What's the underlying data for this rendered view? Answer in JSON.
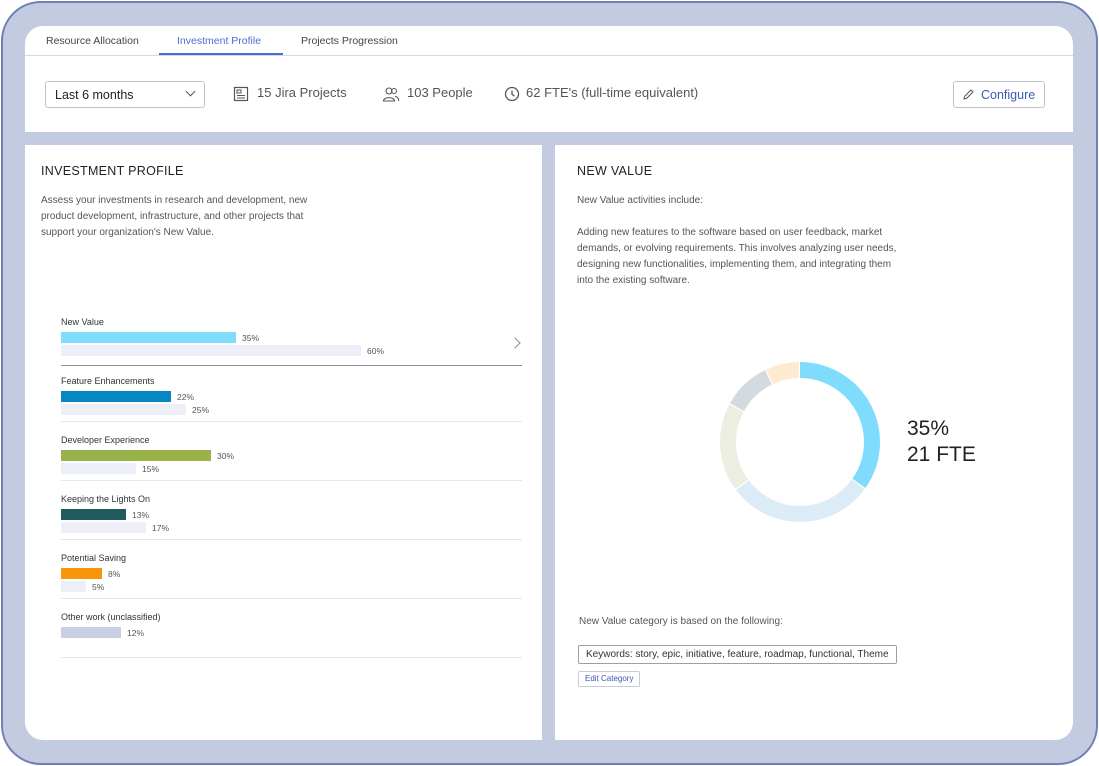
{
  "tabs": [
    {
      "label": "Resource Allocation"
    },
    {
      "label": "Investment Profile"
    },
    {
      "label": "Projects Progression"
    }
  ],
  "filter": {
    "period": "Last 6 months",
    "stats": {
      "projects": "15 Jira Projects",
      "people": "103 People",
      "fte": "62 FTE's (full-time equivalent)"
    },
    "configure_label": "Configure"
  },
  "investment_profile": {
    "title": "INVESTMENT PROFILE",
    "description_lines": [
      "Assess your investments in research and development, new",
      "product development, infrastructure, and other projects that",
      "support your organization's New Value."
    ],
    "categories": [
      {
        "name": "New Value",
        "current": 35,
        "current_label": "35%",
        "benchmark": 60,
        "benchmark_label": "60%",
        "color": "#7fdcfc"
      },
      {
        "name": "Feature Enhancements",
        "current": 22,
        "current_label": "22%",
        "benchmark": 25,
        "benchmark_label": "25%",
        "color": "#0787c2"
      },
      {
        "name": "Developer Experience",
        "current": 30,
        "current_label": "30%",
        "benchmark": 15,
        "benchmark_label": "15%",
        "color": "#99b24a"
      },
      {
        "name": "Keeping the Lights On",
        "current": 13,
        "current_label": "13%",
        "benchmark": 17,
        "benchmark_label": "17%",
        "color": "#1f5a5c"
      },
      {
        "name": "Potential Saving",
        "current": 8,
        "current_label": "8%",
        "benchmark": 5,
        "benchmark_label": "5%",
        "color": "#f7960c"
      },
      {
        "name": "Other work (unclassified)",
        "current": 12,
        "current_label": "12%",
        "color": "#c8cfe2"
      }
    ],
    "benchmark_color": "#eceef8"
  },
  "new_value": {
    "title": "NEW VALUE",
    "intro": "New Value activities include:",
    "description_lines": [
      "Adding new features to the software based on user feedback, market",
      "demands, or evolving requirements. This involves analyzing user needs,",
      "designing new functionalities, implementing them, and integrating them",
      "into the existing software."
    ],
    "donut": {
      "percent": "35%",
      "fte": "21 FTE",
      "segments": [
        {
          "value": 35,
          "color": "#7fdcfc"
        },
        {
          "value": 30,
          "color": "#dcecf6"
        },
        {
          "value": 18,
          "color": "#eceee2"
        },
        {
          "value": 10,
          "color": "#d3dbe0"
        },
        {
          "value": 7,
          "color": "#fcebd0"
        }
      ]
    },
    "basis_text": "New Value category is based on the following:",
    "keywords": "Keywords: story, epic, initiative, feature, roadmap, functional, Theme",
    "edit_label": "Edit Category"
  }
}
